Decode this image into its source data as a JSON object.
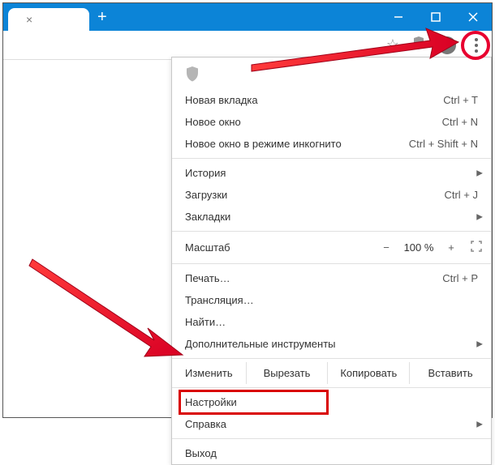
{
  "titlebar": {
    "tab_label": "",
    "tab_close": "×",
    "newtab": "+"
  },
  "menu": {
    "new_tab": {
      "label": "Новая вкладка",
      "shortcut": "Ctrl + T"
    },
    "new_window": {
      "label": "Новое окно",
      "shortcut": "Ctrl + N"
    },
    "incognito": {
      "label": "Новое окно в режиме инкогнито",
      "shortcut": "Ctrl + Shift + N"
    },
    "history": {
      "label": "История"
    },
    "downloads": {
      "label": "Загрузки",
      "shortcut": "Ctrl + J"
    },
    "bookmarks": {
      "label": "Закладки"
    },
    "zoom": {
      "label": "Масштаб",
      "minus": "−",
      "value": "100 %",
      "plus": "+"
    },
    "print": {
      "label": "Печать…",
      "shortcut": "Ctrl + P"
    },
    "cast": {
      "label": "Трансляция…"
    },
    "find": {
      "label": "Найти…"
    },
    "more_tools": {
      "label": "Дополнительные инструменты"
    },
    "edit": {
      "label": "Изменить",
      "cut": "Вырезать",
      "copy": "Копировать",
      "paste": "Вставить"
    },
    "settings": {
      "label": "Настройки"
    },
    "help": {
      "label": "Справка"
    },
    "exit": {
      "label": "Выход"
    }
  }
}
